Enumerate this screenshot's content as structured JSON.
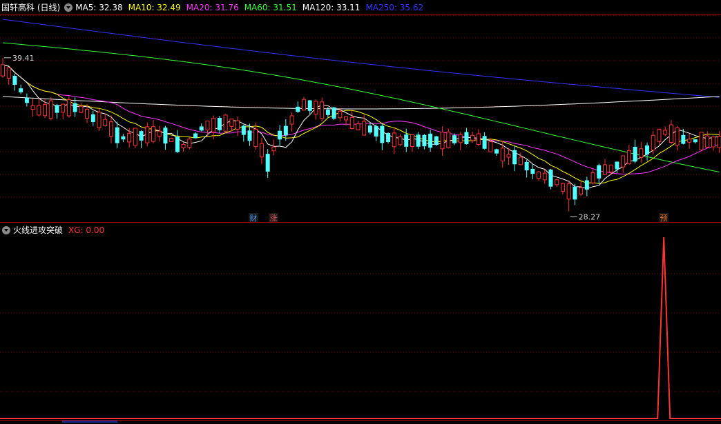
{
  "stock": {
    "title": "国轩高科 (日线)"
  },
  "ma_legend": [
    {
      "label": "MA5: 32.38",
      "color": "#ffffff"
    },
    {
      "label": "MA10: 32.49",
      "color": "#ffff00"
    },
    {
      "label": "MA20: 31.76",
      "color": "#ff33ff"
    },
    {
      "label": "MA60: 31.51",
      "color": "#33ff33"
    },
    {
      "label": "MA120: 33.11",
      "color": "#ffffff"
    },
    {
      "label": "MA250: 35.62",
      "color": "#3333ff"
    }
  ],
  "indicator": {
    "name": "火线进攻突破",
    "xg_label": "XG: 0.00",
    "xg_color": "#ff3333"
  },
  "annotations": {
    "high": "39.41",
    "low": "28.27"
  },
  "markers": [
    {
      "text": "财",
      "color": "#4a90e2"
    },
    {
      "text": "涨",
      "color": "#e05050"
    },
    {
      "text": "预",
      "color": "#e07020"
    }
  ],
  "colors": {
    "up": "#ff3333",
    "down": "#54ffff",
    "grid": "#8a0000"
  },
  "chart_data": {
    "type": "candlestick",
    "count": 120,
    "price_range_visible": [
      27.5,
      42.5
    ],
    "xg_signal": {
      "range": [
        0,
        1
      ],
      "spike_bar": 110,
      "spike_value": 1.0
    }
  }
}
